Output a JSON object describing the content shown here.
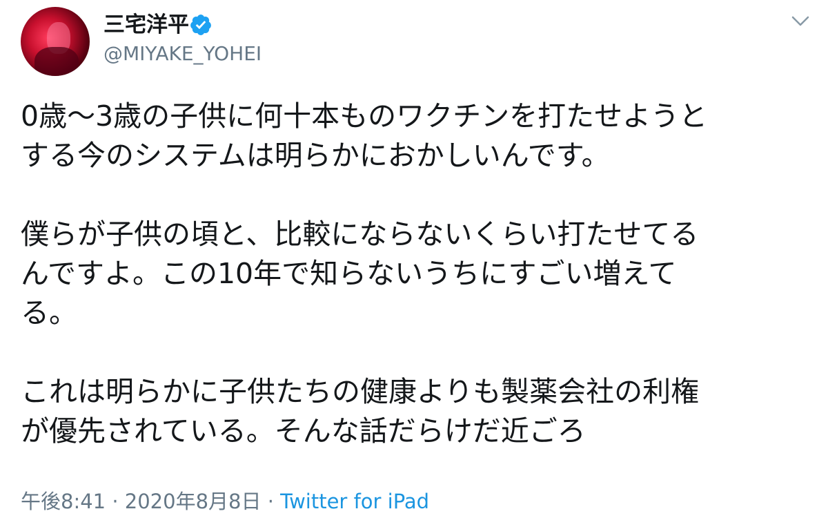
{
  "user": {
    "display_name": "三宅洋平",
    "handle": "@MIYAKE_YOHEI",
    "verified": true
  },
  "tweet": {
    "paragraphs": [
      "0歳〜3歳の子供に何十本ものワクチンを打たせようと\nする今のシステムは明らかにおかしいんです。",
      "僕らが子供の頃と、比較にならないくらい打たせてる\nんですよ。この10年で知らないうちにすごい増えて\nる。",
      "これは明らかに子供たちの健康よりも製薬会社の利権\nが優先されている。そんな話だらけだ近ごろ"
    ]
  },
  "meta": {
    "time": "午後8:41",
    "separator": " · ",
    "date": "2020年8月8日",
    "source": "Twitter for iPad"
  },
  "colors": {
    "text": "#14171a",
    "secondary": "#657786",
    "link": "#1b95e0",
    "verified_badge": "#1da1f2"
  },
  "icons": {
    "verified": "verified-badge-icon",
    "menu": "chevron-down-icon"
  }
}
